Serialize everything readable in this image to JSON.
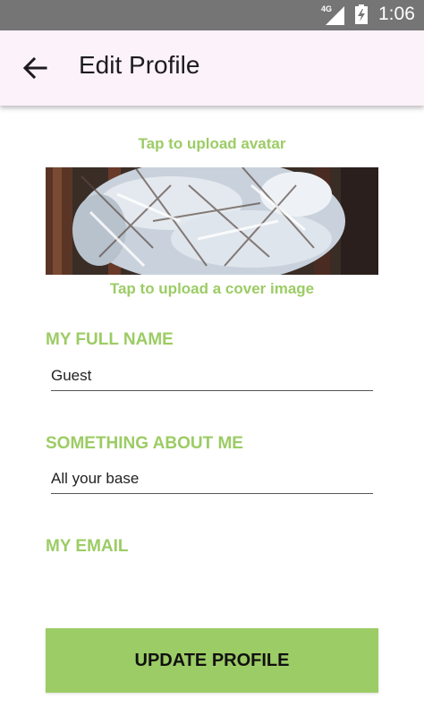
{
  "status_bar": {
    "network": "4G",
    "time": "1:06",
    "icons": [
      "signal-icon",
      "battery-icon"
    ]
  },
  "app_bar": {
    "title": "Edit Profile",
    "back_icon": "arrow-back-icon"
  },
  "upload": {
    "avatar_label": "Tap to upload avatar",
    "cover_label": "Tap to upload a cover image"
  },
  "form": {
    "full_name": {
      "label": "MY FULL NAME",
      "value": "Guest"
    },
    "about": {
      "label": "SOMETHING ABOUT ME",
      "value": "All your base"
    },
    "email": {
      "label": "MY EMAIL",
      "value": ""
    }
  },
  "actions": {
    "update_label": "UPDATE PROFILE"
  },
  "colors": {
    "accent": "#9ccc65",
    "app_bar": "#fcf2fa",
    "status_bar": "#757575"
  }
}
